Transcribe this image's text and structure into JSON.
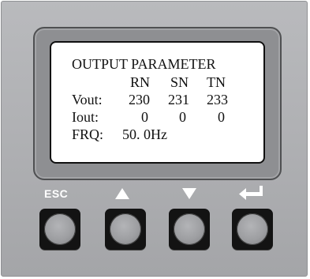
{
  "display": {
    "title": "OUTPUT PARAMETER",
    "columns": [
      "RN",
      "SN",
      "TN"
    ],
    "rows": [
      {
        "label": "Vout:",
        "values": [
          "230",
          "231",
          "233"
        ]
      },
      {
        "label": "Iout:",
        "values": [
          "0",
          "0",
          "0"
        ]
      }
    ],
    "frequency": {
      "label": "FRQ:",
      "value": "50. 0Hz"
    }
  },
  "buttons": [
    {
      "label": "ESC",
      "icon": "esc-text"
    },
    {
      "label": "",
      "icon": "up-arrow-icon"
    },
    {
      "label": "",
      "icon": "down-arrow-icon"
    },
    {
      "label": "",
      "icon": "enter-arrow-icon"
    }
  ],
  "colors": {
    "panel": "#aeafb2",
    "lcd": "#ffffff",
    "key": "#131313"
  }
}
